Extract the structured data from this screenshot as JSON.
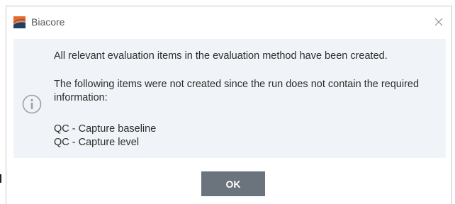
{
  "window": {
    "title": "Biacore",
    "logo_icon": "biacore-logo-icon",
    "close_icon": "close-icon"
  },
  "message": {
    "icon": "info-icon",
    "line1": "All relevant evaluation items in the evaluation method have been created.",
    "line2": "The following items were not created since the run does not contain the required information:",
    "items": [
      "QC - Capture baseline",
      "QC - Capture level"
    ]
  },
  "buttons": {
    "ok_label": "OK"
  },
  "colors": {
    "panel_background": "#f0f3f7",
    "button_background": "#6b747d",
    "logo_orange": "#e8692e",
    "logo_navy": "#1f3f66"
  }
}
